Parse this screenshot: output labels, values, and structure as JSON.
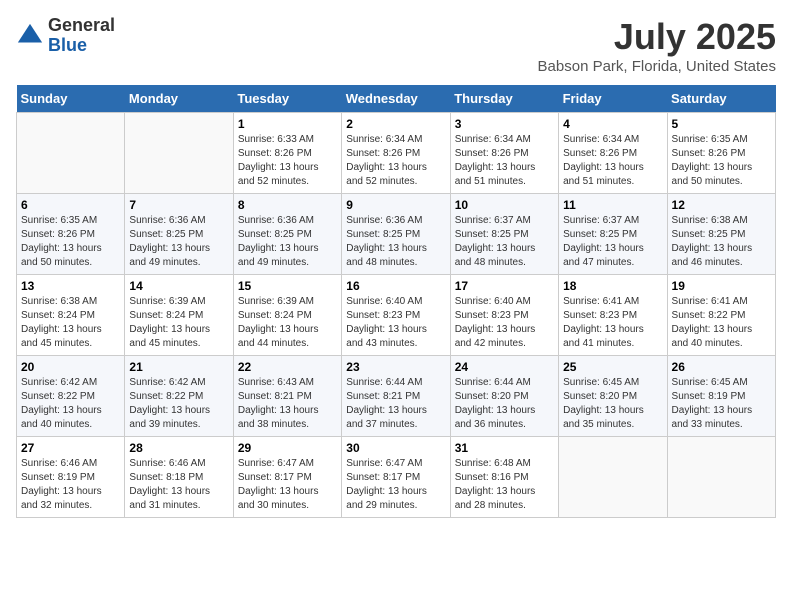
{
  "logo": {
    "general": "General",
    "blue": "Blue"
  },
  "title": "July 2025",
  "subtitle": "Babson Park, Florida, United States",
  "days_header": [
    "Sunday",
    "Monday",
    "Tuesday",
    "Wednesday",
    "Thursday",
    "Friday",
    "Saturday"
  ],
  "weeks": [
    [
      {
        "day": "",
        "sunrise": "",
        "sunset": "",
        "daylight": ""
      },
      {
        "day": "",
        "sunrise": "",
        "sunset": "",
        "daylight": ""
      },
      {
        "day": "1",
        "sunrise": "Sunrise: 6:33 AM",
        "sunset": "Sunset: 8:26 PM",
        "daylight": "Daylight: 13 hours and 52 minutes."
      },
      {
        "day": "2",
        "sunrise": "Sunrise: 6:34 AM",
        "sunset": "Sunset: 8:26 PM",
        "daylight": "Daylight: 13 hours and 52 minutes."
      },
      {
        "day": "3",
        "sunrise": "Sunrise: 6:34 AM",
        "sunset": "Sunset: 8:26 PM",
        "daylight": "Daylight: 13 hours and 51 minutes."
      },
      {
        "day": "4",
        "sunrise": "Sunrise: 6:34 AM",
        "sunset": "Sunset: 8:26 PM",
        "daylight": "Daylight: 13 hours and 51 minutes."
      },
      {
        "day": "5",
        "sunrise": "Sunrise: 6:35 AM",
        "sunset": "Sunset: 8:26 PM",
        "daylight": "Daylight: 13 hours and 50 minutes."
      }
    ],
    [
      {
        "day": "6",
        "sunrise": "Sunrise: 6:35 AM",
        "sunset": "Sunset: 8:26 PM",
        "daylight": "Daylight: 13 hours and 50 minutes."
      },
      {
        "day": "7",
        "sunrise": "Sunrise: 6:36 AM",
        "sunset": "Sunset: 8:25 PM",
        "daylight": "Daylight: 13 hours and 49 minutes."
      },
      {
        "day": "8",
        "sunrise": "Sunrise: 6:36 AM",
        "sunset": "Sunset: 8:25 PM",
        "daylight": "Daylight: 13 hours and 49 minutes."
      },
      {
        "day": "9",
        "sunrise": "Sunrise: 6:36 AM",
        "sunset": "Sunset: 8:25 PM",
        "daylight": "Daylight: 13 hours and 48 minutes."
      },
      {
        "day": "10",
        "sunrise": "Sunrise: 6:37 AM",
        "sunset": "Sunset: 8:25 PM",
        "daylight": "Daylight: 13 hours and 48 minutes."
      },
      {
        "day": "11",
        "sunrise": "Sunrise: 6:37 AM",
        "sunset": "Sunset: 8:25 PM",
        "daylight": "Daylight: 13 hours and 47 minutes."
      },
      {
        "day": "12",
        "sunrise": "Sunrise: 6:38 AM",
        "sunset": "Sunset: 8:25 PM",
        "daylight": "Daylight: 13 hours and 46 minutes."
      }
    ],
    [
      {
        "day": "13",
        "sunrise": "Sunrise: 6:38 AM",
        "sunset": "Sunset: 8:24 PM",
        "daylight": "Daylight: 13 hours and 45 minutes."
      },
      {
        "day": "14",
        "sunrise": "Sunrise: 6:39 AM",
        "sunset": "Sunset: 8:24 PM",
        "daylight": "Daylight: 13 hours and 45 minutes."
      },
      {
        "day": "15",
        "sunrise": "Sunrise: 6:39 AM",
        "sunset": "Sunset: 8:24 PM",
        "daylight": "Daylight: 13 hours and 44 minutes."
      },
      {
        "day": "16",
        "sunrise": "Sunrise: 6:40 AM",
        "sunset": "Sunset: 8:23 PM",
        "daylight": "Daylight: 13 hours and 43 minutes."
      },
      {
        "day": "17",
        "sunrise": "Sunrise: 6:40 AM",
        "sunset": "Sunset: 8:23 PM",
        "daylight": "Daylight: 13 hours and 42 minutes."
      },
      {
        "day": "18",
        "sunrise": "Sunrise: 6:41 AM",
        "sunset": "Sunset: 8:23 PM",
        "daylight": "Daylight: 13 hours and 41 minutes."
      },
      {
        "day": "19",
        "sunrise": "Sunrise: 6:41 AM",
        "sunset": "Sunset: 8:22 PM",
        "daylight": "Daylight: 13 hours and 40 minutes."
      }
    ],
    [
      {
        "day": "20",
        "sunrise": "Sunrise: 6:42 AM",
        "sunset": "Sunset: 8:22 PM",
        "daylight": "Daylight: 13 hours and 40 minutes."
      },
      {
        "day": "21",
        "sunrise": "Sunrise: 6:42 AM",
        "sunset": "Sunset: 8:22 PM",
        "daylight": "Daylight: 13 hours and 39 minutes."
      },
      {
        "day": "22",
        "sunrise": "Sunrise: 6:43 AM",
        "sunset": "Sunset: 8:21 PM",
        "daylight": "Daylight: 13 hours and 38 minutes."
      },
      {
        "day": "23",
        "sunrise": "Sunrise: 6:44 AM",
        "sunset": "Sunset: 8:21 PM",
        "daylight": "Daylight: 13 hours and 37 minutes."
      },
      {
        "day": "24",
        "sunrise": "Sunrise: 6:44 AM",
        "sunset": "Sunset: 8:20 PM",
        "daylight": "Daylight: 13 hours and 36 minutes."
      },
      {
        "day": "25",
        "sunrise": "Sunrise: 6:45 AM",
        "sunset": "Sunset: 8:20 PM",
        "daylight": "Daylight: 13 hours and 35 minutes."
      },
      {
        "day": "26",
        "sunrise": "Sunrise: 6:45 AM",
        "sunset": "Sunset: 8:19 PM",
        "daylight": "Daylight: 13 hours and 33 minutes."
      }
    ],
    [
      {
        "day": "27",
        "sunrise": "Sunrise: 6:46 AM",
        "sunset": "Sunset: 8:19 PM",
        "daylight": "Daylight: 13 hours and 32 minutes."
      },
      {
        "day": "28",
        "sunrise": "Sunrise: 6:46 AM",
        "sunset": "Sunset: 8:18 PM",
        "daylight": "Daylight: 13 hours and 31 minutes."
      },
      {
        "day": "29",
        "sunrise": "Sunrise: 6:47 AM",
        "sunset": "Sunset: 8:17 PM",
        "daylight": "Daylight: 13 hours and 30 minutes."
      },
      {
        "day": "30",
        "sunrise": "Sunrise: 6:47 AM",
        "sunset": "Sunset: 8:17 PM",
        "daylight": "Daylight: 13 hours and 29 minutes."
      },
      {
        "day": "31",
        "sunrise": "Sunrise: 6:48 AM",
        "sunset": "Sunset: 8:16 PM",
        "daylight": "Daylight: 13 hours and 28 minutes."
      },
      {
        "day": "",
        "sunrise": "",
        "sunset": "",
        "daylight": ""
      },
      {
        "day": "",
        "sunrise": "",
        "sunset": "",
        "daylight": ""
      }
    ]
  ]
}
